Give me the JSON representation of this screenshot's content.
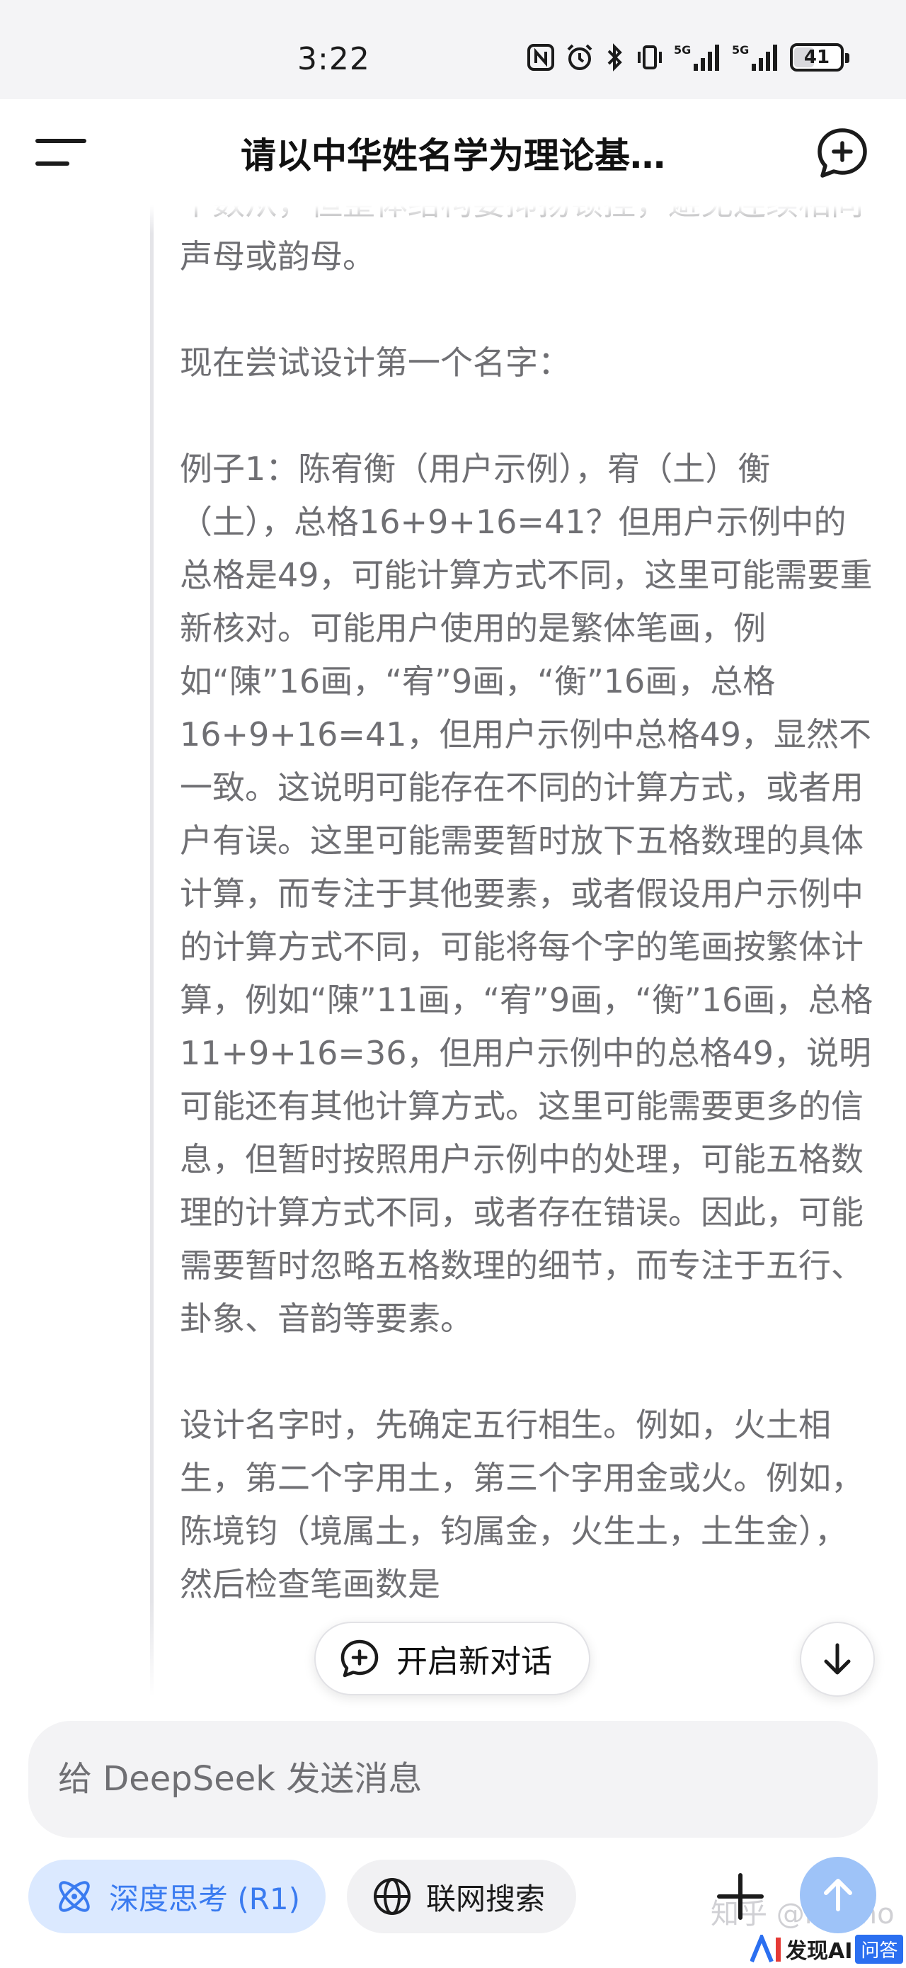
{
  "status_bar": {
    "time": "3:22",
    "network_1": "5G",
    "network_2": "5G",
    "battery": "41"
  },
  "header": {
    "title": "请以中华姓名学为理论基…",
    "menu_icon": "menu-icon",
    "new_chat_icon": "chat-plus-icon"
  },
  "thinking": {
    "paragraphs": [
      "个数从，但整体结构要抑扬顿挫，避免连续相同声母或韵母。",
      "现在尝试设计第一个名字：",
      "例子1：陈宥衡（用户示例），宥（土）衡（土），总格16+9+16=41？但用户示例中的总格是49，可能计算方式不同，这里可能需要重新核对。可能用户使用的是繁体笔画，例如“陳”16画，“宥”9画，“衡”16画，总格16+9+16=41，但用户示例中总格49，显然不一致。这说明可能存在不同的计算方式，或者用户有误。这里可能需要暂时放下五格数理的具体计算，而专注于其他要素，或者假设用户示例中的计算方式不同，可能将每个字的笔画按繁体计算，例如“陳”11画，“宥”9画，“衡”16画，总格11+9+16=36，但用户示例中的总格49，说明可能还有其他计算方式。这里可能需要更多的信息，但暂时按照用户示例中的处理，可能五格数理的计算方式不同，或者存在错误。因此，可能需要暂时忽略五格数理的细节，而专注于五行、卦象、音韵等要素。",
      "设计名字时，先确定五行相生。例如，火土相生，第二个字用土，第三个字用金或火。例如，陈境钧（境属土，钧属金，火生土，土生金），然后检查笔画数是"
    ]
  },
  "floating": {
    "new_dialog_label": "开启新对话",
    "new_dialog_icon": "chat-plus-icon",
    "scroll_down_icon": "arrow-down-icon"
  },
  "composer": {
    "placeholder": "给 DeepSeek 发送消息",
    "value": ""
  },
  "toolbar": {
    "deep_think_label": "深度思考 (R1)",
    "deep_think_icon": "atom-icon",
    "web_search_label": "联网搜索",
    "web_search_icon": "globe-icon",
    "attach_icon": "plus-icon",
    "send_icon": "arrow-up-icon"
  },
  "colors": {
    "accent": "#3a7bf0",
    "accent_bg": "#dbe9ff",
    "send_bg": "#9ec3f8",
    "thinking_text": "#6f6f73"
  },
  "watermark": {
    "zhihu": "知乎 @momo",
    "brand": "发现AI",
    "badge": "问答"
  }
}
